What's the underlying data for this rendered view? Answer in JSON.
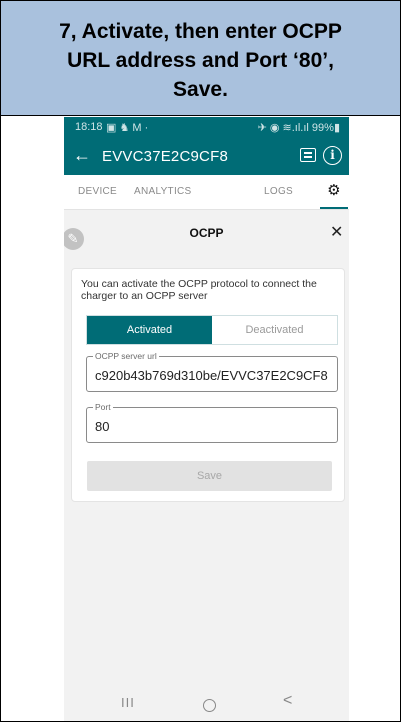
{
  "banner": {
    "text": "7, Activate, then enter OCPP\nURL address and Port ‘80’,\nSave."
  },
  "statusbar": {
    "time": "18:18",
    "left_icons": "▣ ♞ M ·",
    "right": "✈ ◉ ≋.ıl.ıl 99%▮"
  },
  "appbar": {
    "back_icon": "←",
    "title": "EVVC37E2C9CF8",
    "info_icon": "i"
  },
  "tabs": [
    {
      "label": "DEVICE"
    },
    {
      "label": "ANALYTICS"
    },
    {
      "label": "LOGS"
    },
    {
      "label": "⚙"
    }
  ],
  "modal": {
    "pencil_icon": "✎",
    "title": "OCPP",
    "close_icon": "✕",
    "description": "You can activate the OCPP protocol to connect the charger to an OCPP server",
    "segment": {
      "active": "Activated",
      "inactive": "Deactivated"
    },
    "url_field": {
      "label": "OCPP server url",
      "value": "c920b43b769d310be/EVVC37E2C9CF8"
    },
    "port_field": {
      "label": "Port",
      "value": "80"
    },
    "save_label": "Save"
  },
  "navbar": {
    "recent": "III",
    "back": "<"
  },
  "colors": {
    "banner_bg": "#a9c1dd",
    "accent": "#006c76",
    "page_bg": "#f2f2f2"
  }
}
